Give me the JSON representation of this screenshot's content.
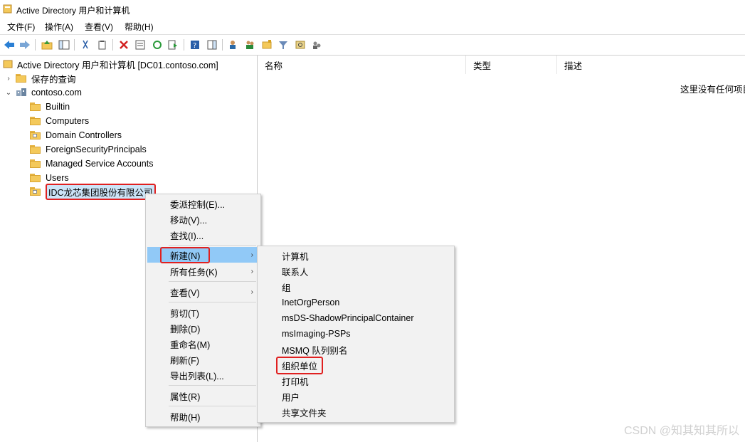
{
  "window": {
    "title": "Active Directory 用户和计算机"
  },
  "menubar": [
    "文件(F)",
    "操作(A)",
    "查看(V)",
    "帮助(H)"
  ],
  "toolbar": {
    "icons": [
      "back-arrow-icon",
      "forward-arrow-icon",
      "up-level-icon",
      "show-hide-tree-icon",
      "cut-icon",
      "copy-icon",
      "delete-icon",
      "properties-icon",
      "refresh-icon",
      "export-list-icon",
      "help-icon",
      "show-action-pane-icon",
      "new-user-icon",
      "new-group-icon",
      "new-ou-icon",
      "filter-icon",
      "find-icon",
      "add-to-group-icon"
    ]
  },
  "tree": {
    "root": "Active Directory 用户和计算机 [DC01.contoso.com]",
    "saved_queries": "保存的查询",
    "domain": "contoso.com",
    "containers": [
      "Builtin",
      "Computers",
      "Domain Controllers",
      "ForeignSecurityPrincipals",
      "Managed Service Accounts",
      "Users",
      "IDC龙芯集团股份有限公司"
    ]
  },
  "list": {
    "columns": [
      "名称",
      "类型",
      "描述"
    ],
    "empty_text": "这里没有任何项目"
  },
  "context_menu": {
    "items": [
      "委派控制(E)...",
      "移动(V)...",
      "查找(I)...",
      "新建(N)",
      "所有任务(K)",
      "查看(V)",
      "剪切(T)",
      "删除(D)",
      "重命名(M)",
      "刷新(F)",
      "导出列表(L)...",
      "属性(R)",
      "帮助(H)"
    ]
  },
  "submenu": {
    "items": [
      "计算机",
      "联系人",
      "组",
      "InetOrgPerson",
      "msDS-ShadowPrincipalContainer",
      "msImaging-PSPs",
      "MSMQ 队列别名",
      "组织单位",
      "打印机",
      "用户",
      "共享文件夹"
    ]
  },
  "watermark": "CSDN @知其知其所以"
}
